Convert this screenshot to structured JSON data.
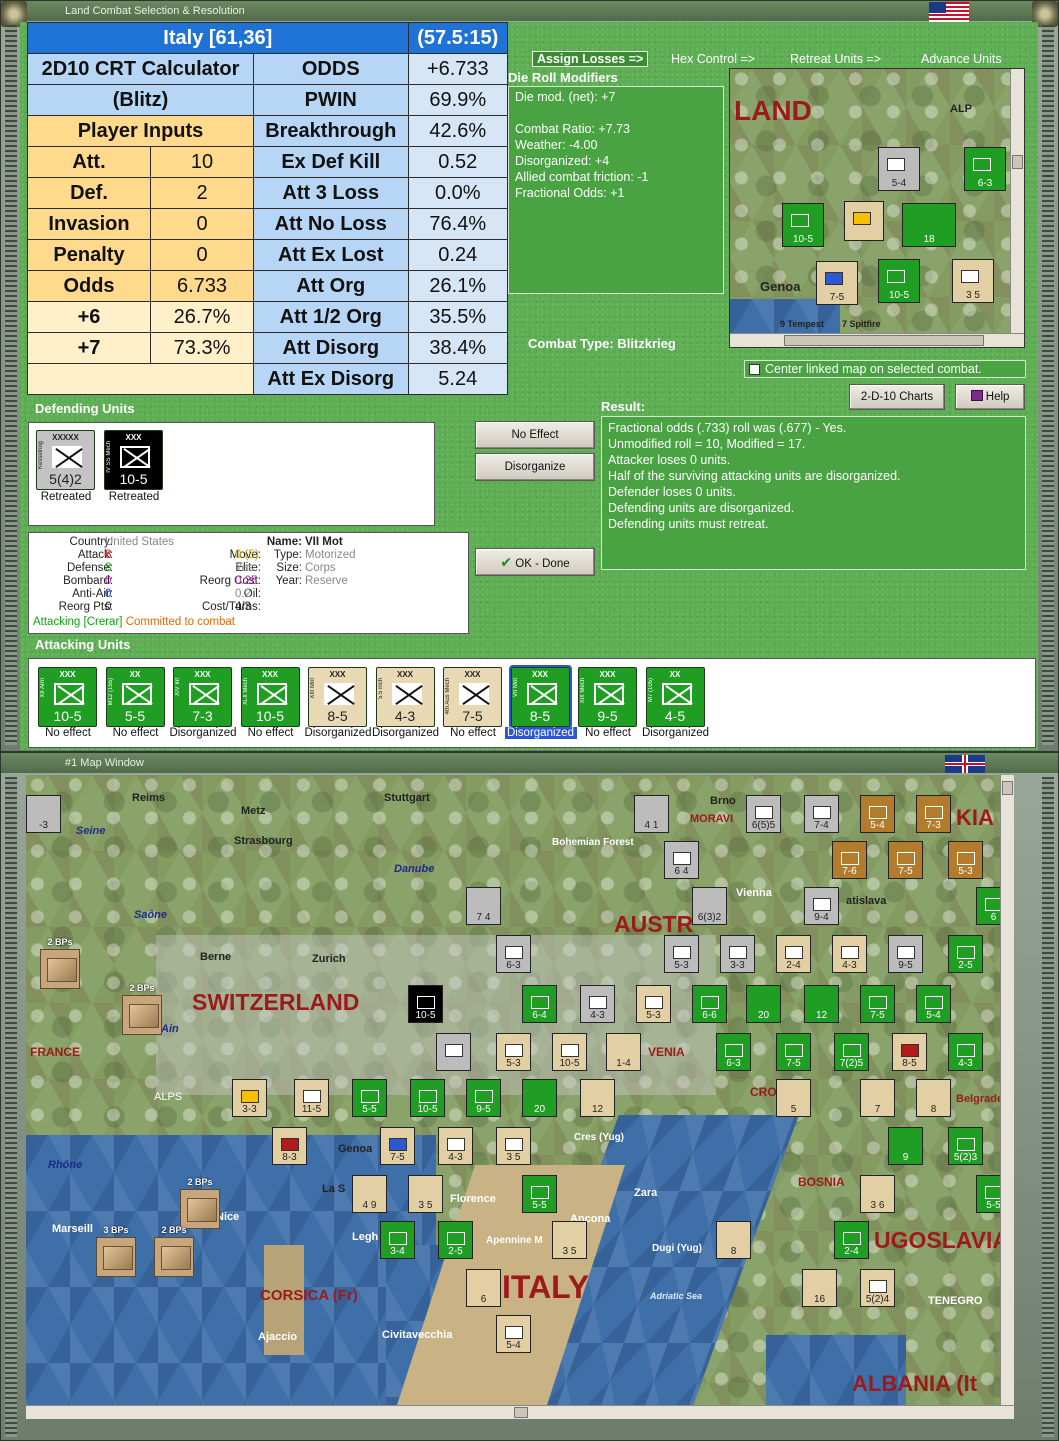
{
  "window1": {
    "title": "Land Combat Selection & Resolution"
  },
  "window2": {
    "title": "#1 Map Window"
  },
  "crt": {
    "header_left": "Italy [61,36]",
    "header_right": "(57.5:15)",
    "calc_title_1": "2D10 CRT Calculator",
    "calc_title_2": "(Blitz)",
    "player_inputs": "Player Inputs",
    "inputs": [
      {
        "label": "Att.",
        "value": "10"
      },
      {
        "label": "Def.",
        "value": "2"
      },
      {
        "label": "Invasion",
        "value": "0"
      },
      {
        "label": "Penalty",
        "value": "0"
      },
      {
        "label": "Odds",
        "value": "6.733"
      },
      {
        "label": "+6",
        "value": "26.7%"
      },
      {
        "label": "+7",
        "value": "73.3%"
      }
    ],
    "results": [
      {
        "label": "ODDS",
        "value": "+6.733"
      },
      {
        "label": "PWIN",
        "value": "69.9%"
      },
      {
        "label": "Breakthrough",
        "value": "42.6%"
      },
      {
        "label": "Ex Def Kill",
        "value": "0.52"
      },
      {
        "label": "Att 3 Loss",
        "value": "0.0%"
      },
      {
        "label": "Att No Loss",
        "value": "76.4%"
      },
      {
        "label": "Att Ex Lost",
        "value": "0.24"
      },
      {
        "label": "Att Org",
        "value": "26.1%"
      },
      {
        "label": "Att 1/2 Org",
        "value": "35.5%"
      },
      {
        "label": "Att Disorg",
        "value": "38.4%"
      },
      {
        "label": "Att Ex Disorg",
        "value": "5.24"
      }
    ]
  },
  "tabs": [
    "Assign Losses =>",
    "Hex Control =>",
    "Retreat Units =>",
    "Advance Units"
  ],
  "die_roll": {
    "title": "Die Roll Modifiers",
    "lines": [
      "Die mod. (net): +7",
      "",
      "Combat Ratio: +7.73",
      "Weather: -4.00",
      "Disorganized: +4",
      "Allied combat friction: -1",
      "Fractional Odds: +1"
    ]
  },
  "combat_type": "Combat Type:  Blitzkrieg",
  "center_linked": "Center linked map on selected combat.",
  "buttons": {
    "charts": "2-D-10 Charts",
    "help": "Help",
    "no_effect": "No Effect",
    "disorganize": "Disorganize",
    "ok_done": "OK - Done"
  },
  "result": {
    "title": "Result:",
    "lines": [
      "Fractional odds (.733) roll was (.677)  - Yes.",
      "Unmodified roll = 10, Modified = 17.",
      "Attacker loses 0 units.",
      "Half of the surviving attacking units are disorganized.",
      "Defender loses 0 units.",
      "Defending units are disorganized.",
      "Defending units must retreat."
    ]
  },
  "defending": {
    "title": "Defending Units",
    "units": [
      {
        "size": "XXXXX",
        "side": "Kesselring",
        "vals": "5(4)2",
        "status": "Retreated",
        "color": "grey"
      },
      {
        "size": "XXX",
        "side": "IV SS Mech",
        "vals": "10-5",
        "status": "Retreated",
        "color": "black"
      }
    ]
  },
  "unit_info": {
    "country_label": "Country:",
    "country": "United States",
    "attack_label": "Attack:",
    "attack": "8",
    "defense_label": "Defense:",
    "defense": "8",
    "bombard_label": "Bombard:",
    "bombard": "0",
    "antiair_label": "Anti-Air:",
    "antiair": "0",
    "reorg_label": "Reorg Pts:",
    "reorg": "0",
    "move_label": "Move:",
    "move": "0 (5)",
    "elite_label": "Elite:",
    "elite": "Yes",
    "reorgcost_label": "Reorg Cost:",
    "reorgcost": "0.25",
    "oil_label": "Oil:",
    "oil": "0.2",
    "costturns_label": "Cost/Turns:",
    "costturns": "4/3",
    "name_label": "Name:",
    "name": "VII Mot",
    "type_label": "Type:",
    "type": "Motorized",
    "size_label": "Size:",
    "size": "Corps",
    "year_label": "Year:",
    "year": "Reserve",
    "attacking": "Attacking [Crerar]",
    "committed": "Committed to combat"
  },
  "attacking": {
    "title": "Attacking Units",
    "units": [
      {
        "size": "XXX",
        "side": "XII Arm",
        "vals": "10-5",
        "status": "No effect",
        "color": "green"
      },
      {
        "size": "XX",
        "side": "M12 (155)",
        "vals": "5-5",
        "status": "No effect",
        "color": "green"
      },
      {
        "size": "XXX",
        "side": "XIV Inf",
        "vals": "7-3",
        "status": "Disorganized",
        "color": "green"
      },
      {
        "size": "XXX",
        "side": "XLII Mech",
        "vals": "10-5",
        "status": "No effect",
        "color": "green"
      },
      {
        "size": "XXX",
        "side": "XIII Mot",
        "vals": "8-5",
        "status": "Disorganized",
        "color": "tan"
      },
      {
        "size": "XXX",
        "side": "5.5 inch",
        "vals": "4-3",
        "status": "Disorganized",
        "color": "tan"
      },
      {
        "size": "XXX",
        "side": "4th Aus Mech",
        "vals": "7-5",
        "status": "No effect",
        "color": "tan"
      },
      {
        "size": "XXX",
        "side": "VII Mot",
        "vals": "8-5",
        "status": "Disorganized",
        "color": "green"
      },
      {
        "size": "XXX",
        "side": "XIII Mech",
        "vals": "9-5",
        "status": "No effect",
        "color": "green"
      },
      {
        "size": "XX",
        "side": "M7 (105)",
        "vals": "4-5",
        "status": "Disorganized",
        "color": "green"
      }
    ]
  },
  "minimap": {
    "land": "LAND",
    "alp": "ALP",
    "genoa": "Genoa",
    "tempest": "9 Tempest",
    "spitfire": "7 Spitfire"
  },
  "map": {
    "labels": {
      "switzerland": "SWITZERLAND",
      "austria": "AUSTR",
      "italy": "ITALY",
      "yugoslavia": "UGOSLAVIA",
      "albania": "ALBANIA (It",
      "corsica": "CORSICA (Fr)",
      "france": "FRANCE",
      "croatia": "CROATIA",
      "bosnia": "BOSNIA",
      "slovakia": "KIA",
      "venia": "VENIA"
    },
    "cities": [
      "Reims",
      "Metz",
      "Stuttgart",
      "Strasbourg",
      "Brno",
      "MORAVI",
      "Bohemian Forest",
      "Danube",
      "Seine",
      "Saône",
      "Vienna",
      "atislava",
      "Berne",
      "Zurich",
      "Ain",
      "ALPS",
      "Genoa",
      "La S",
      "Florence",
      "Ancona",
      "Legh",
      "Apennine M",
      "Zara",
      "Dugi (Yug)",
      "Civitavecchia",
      "Ajaccio",
      "Marseill",
      "Nice",
      "Rhône",
      "Cres (Yug)",
      "Adriatic Sea",
      "Belgrade",
      "TENEGRO"
    ],
    "bp_label": "2 BPs",
    "bp_label_3": "3 BPs"
  }
}
